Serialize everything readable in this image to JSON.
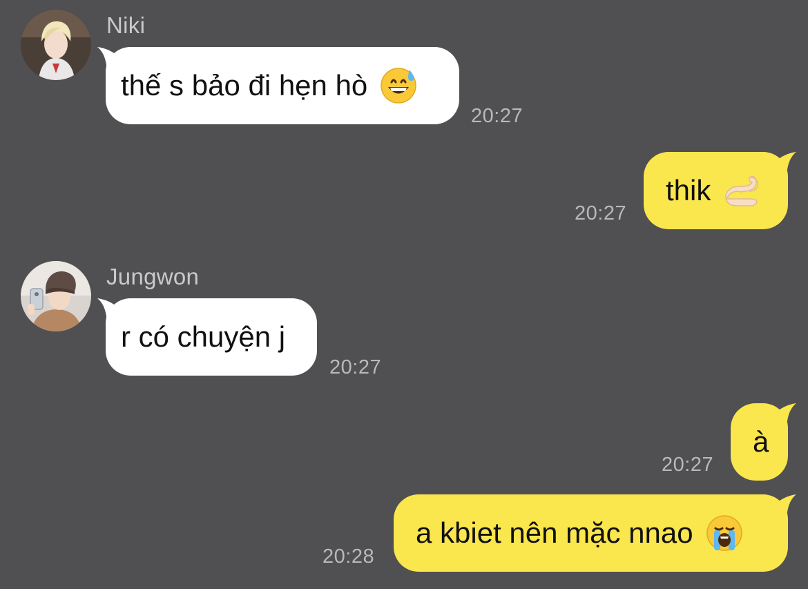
{
  "conversation": {
    "messages": [
      {
        "sender": "Niki",
        "direction": "incoming",
        "text": "thế s bảo đi hẹn hò",
        "emoji": "grinning-sweat-emoji",
        "time": "20:27"
      },
      {
        "direction": "outgoing",
        "text": "thik",
        "emoji": "pinched-fingers-emoji",
        "time": "20:27"
      },
      {
        "sender": "Jungwon",
        "direction": "incoming",
        "text": "r có chuyện j",
        "time": "20:27"
      },
      {
        "direction": "outgoing",
        "text": "à",
        "time": "20:27"
      },
      {
        "direction": "outgoing",
        "text": "a kbiet nên mặc nnao",
        "emoji": "loudly-crying-emoji",
        "time": "20:28"
      }
    ]
  },
  "colors": {
    "background": "#504f52",
    "incoming_bubble": "#ffffff",
    "outgoing_bubble": "#fae64d",
    "timestamp": "#b9b9bb",
    "sender_name": "#c9c9cb"
  }
}
